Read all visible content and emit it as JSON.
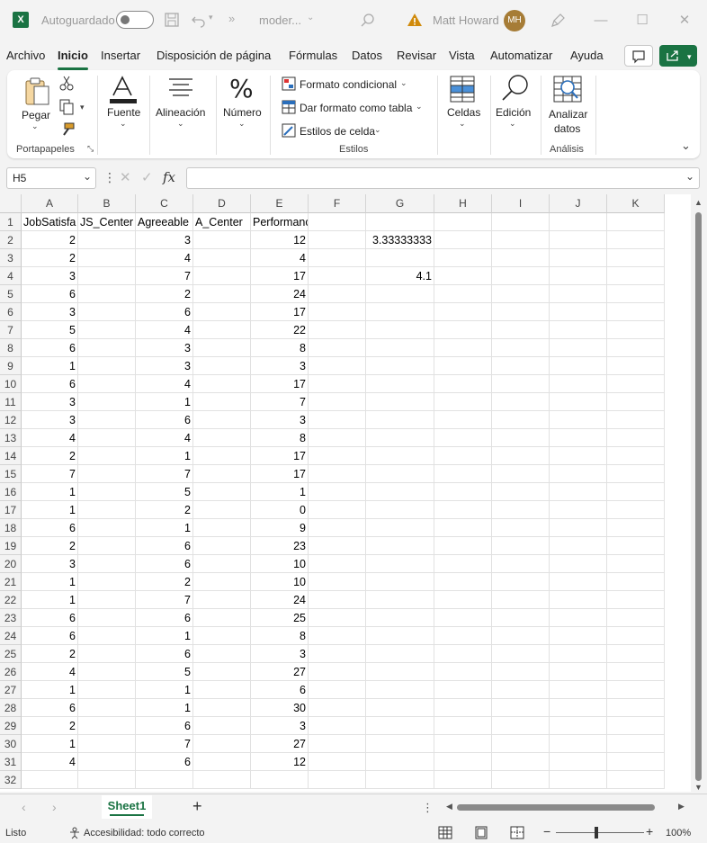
{
  "title_bar": {
    "autosave_label": "Autoguardado",
    "filename": "moder...",
    "user_name": "Matt Howard",
    "user_initials": "MH"
  },
  "menu": [
    "Archivo",
    "Inicio",
    "Insertar",
    "Disposición de página",
    "Fórmulas",
    "Datos",
    "Revisar",
    "Vista",
    "Automatizar",
    "Ayuda"
  ],
  "ribbon": {
    "paste": "Pegar",
    "font": "Fuente",
    "alignment": "Alineación",
    "number": "Número",
    "conditional_format": "Formato condicional",
    "format_as_table": "Dar formato como tabla",
    "cell_styles": "Estilos de celda",
    "cells": "Celdas",
    "editing": "Edición",
    "analyze_line1": "Analizar",
    "analyze_line2": "datos",
    "group_clipboard": "Portapapeles",
    "group_styles": "Estilos",
    "group_analysis": "Análisis"
  },
  "formula_bar": {
    "name_box": "H5",
    "fx_label": "fx",
    "formula": ""
  },
  "grid": {
    "columns": [
      "A",
      "B",
      "C",
      "D",
      "E",
      "F",
      "G",
      "H",
      "I",
      "J",
      "K"
    ],
    "headers": [
      "JobSatisfa",
      "JS_Center",
      "Agreeable",
      "A_Center",
      "Performance"
    ],
    "col_a": [
      "2",
      "2",
      "3",
      "6",
      "3",
      "5",
      "6",
      "1",
      "6",
      "3",
      "3",
      "4",
      "2",
      "7",
      "1",
      "1",
      "6",
      "2",
      "3",
      "1",
      "1",
      "6",
      "6",
      "2",
      "4",
      "1",
      "6",
      "2",
      "1",
      "4"
    ],
    "col_c": [
      "3",
      "4",
      "7",
      "2",
      "6",
      "4",
      "3",
      "3",
      "4",
      "1",
      "6",
      "4",
      "1",
      "7",
      "5",
      "2",
      "1",
      "6",
      "6",
      "2",
      "7",
      "6",
      "1",
      "6",
      "5",
      "1",
      "1",
      "6",
      "7",
      "6"
    ],
    "col_e": [
      "12",
      "4",
      "17",
      "24",
      "17",
      "22",
      "8",
      "3",
      "17",
      "7",
      "3",
      "8",
      "17",
      "17",
      "1",
      "0",
      "9",
      "23",
      "10",
      "10",
      "24",
      "25",
      "8",
      "3",
      "27",
      "6",
      "30",
      "3",
      "27",
      "12"
    ],
    "g2": "3.33333333",
    "g4": "4.1"
  },
  "sheet_tabs": [
    "Sheet1"
  ],
  "status": {
    "ready": "Listo",
    "accessibility": "Accesibilidad: todo correcto",
    "zoom": "100%"
  },
  "colors": {
    "accent": "#1a7343",
    "avatar": "#a67c36"
  }
}
